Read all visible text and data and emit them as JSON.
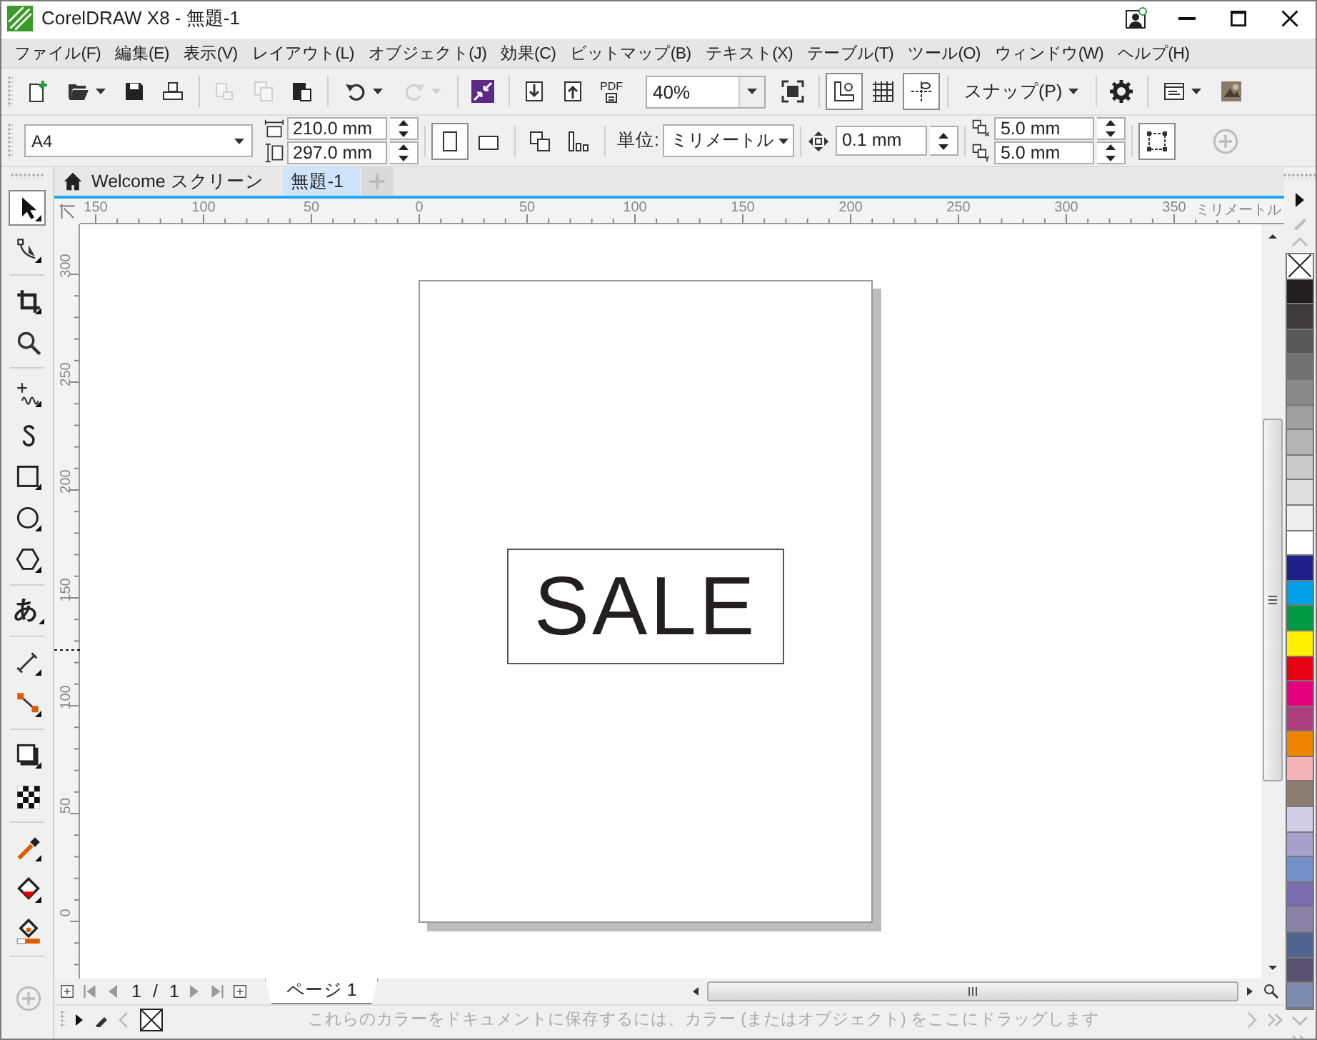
{
  "window": {
    "title": "CorelDRAW X8 - 無題-1"
  },
  "menu": [
    "ファイル(F)",
    "編集(E)",
    "表示(V)",
    "レイアウト(L)",
    "オブジェクト(J)",
    "効果(C)",
    "ビットマップ(B)",
    "テキスト(X)",
    "テーブル(T)",
    "ツール(O)",
    "ウィンドウ(W)",
    "ヘルプ(H)"
  ],
  "toolbar": [
    {
      "kind": "new",
      "disabled": false
    },
    {
      "kind": "open",
      "disabled": false
    },
    {
      "kind": "save",
      "disabled": false
    },
    {
      "kind": "print",
      "disabled": false
    },
    {
      "kind": "sep"
    },
    {
      "kind": "cut",
      "disabled": true
    },
    {
      "kind": "copy",
      "disabled": true
    },
    {
      "kind": "paste",
      "disabled": false
    },
    {
      "kind": "sep"
    },
    {
      "kind": "undo",
      "disabled": false
    },
    {
      "kind": "redo",
      "disabled": true
    },
    {
      "kind": "sep"
    },
    {
      "kind": "launch",
      "disabled": false
    },
    {
      "kind": "sep"
    },
    {
      "kind": "import",
      "disabled": false
    },
    {
      "kind": "export",
      "disabled": false
    },
    {
      "kind": "pdf",
      "label": "PDF",
      "disabled": false
    },
    {
      "kind": "zoom",
      "value": "40%"
    },
    {
      "kind": "fullscreen",
      "disabled": false
    },
    {
      "kind": "sep"
    },
    {
      "kind": "rulers",
      "on": true
    },
    {
      "kind": "grid",
      "on": false
    },
    {
      "kind": "guides",
      "on": true
    },
    {
      "kind": "sep"
    },
    {
      "kind": "snap",
      "label": "スナップ(P)"
    },
    {
      "kind": "sep"
    },
    {
      "kind": "options",
      "disabled": false
    },
    {
      "kind": "sep"
    },
    {
      "kind": "window",
      "disabled": false
    },
    {
      "kind": "thumb",
      "disabled": false
    }
  ],
  "property_bar": {
    "page_size": "A4",
    "width": "210.0 mm",
    "height": "297.0 mm",
    "orientation": [
      {
        "kind": "portrait",
        "selected": true
      },
      {
        "kind": "landscape",
        "selected": false
      }
    ],
    "units_label": "単位:",
    "units": "ミリメートル",
    "nudge": "0.1 mm",
    "duplicate_x": "5.0 mm",
    "duplicate_y": "5.0 mm"
  },
  "tabs": [
    {
      "label": "Welcome スクリーン",
      "kind": "home",
      "selected": false
    },
    {
      "label": "無題-1",
      "kind": "doc",
      "selected": true
    }
  ],
  "ruler_h": {
    "labels": [
      "150",
      "100",
      "50",
      "0",
      "50",
      "100",
      "150",
      "200",
      "250",
      "300",
      "350"
    ],
    "unit": "ミリメートル"
  },
  "ruler_v": {
    "labels": [
      "300",
      "250",
      "200",
      "150",
      "100",
      "50",
      "0"
    ]
  },
  "toolbox": [
    {
      "tools": [
        {
          "kind": "pick",
          "selected": true
        },
        {
          "kind": "shape",
          "selected": false
        }
      ]
    },
    {
      "tools": [
        {
          "kind": "crop",
          "selected": false
        },
        {
          "kind": "zoom",
          "selected": false
        }
      ]
    },
    {
      "tools": [
        {
          "kind": "freehand",
          "selected": false
        },
        {
          "kind": "artistic",
          "selected": false
        },
        {
          "kind": "rectangle",
          "selected": false
        },
        {
          "kind": "ellipse",
          "selected": false
        },
        {
          "kind": "polygon",
          "selected": false
        }
      ]
    },
    {
      "tools": [
        {
          "kind": "text",
          "glyph": "あ",
          "selected": false
        }
      ]
    },
    {
      "tools": [
        {
          "kind": "dimension",
          "selected": false
        },
        {
          "kind": "connector",
          "selected": false
        }
      ]
    },
    {
      "tools": [
        {
          "kind": "shadow",
          "selected": false
        },
        {
          "kind": "transparency",
          "selected": false
        }
      ]
    },
    {
      "tools": [
        {
          "kind": "eyedropper",
          "selected": false
        },
        {
          "kind": "fill",
          "selected": false
        },
        {
          "kind": "smartfill",
          "selected": false
        }
      ]
    }
  ],
  "canvas": {
    "text": "SALE"
  },
  "page_nav": {
    "current": "1",
    "separator": "/",
    "total": "1",
    "page_tab": "ページ 1"
  },
  "palette": [
    {
      "kind": "none"
    },
    {
      "kind": "color",
      "color": "#231f20"
    },
    {
      "kind": "color",
      "color": "#3e3a39"
    },
    {
      "kind": "color",
      "color": "#595757"
    },
    {
      "kind": "color",
      "color": "#727171"
    },
    {
      "kind": "color",
      "color": "#898989"
    },
    {
      "kind": "color",
      "color": "#9fa0a0"
    },
    {
      "kind": "color",
      "color": "#b5b5b6"
    },
    {
      "kind": "color",
      "color": "#c9caca"
    },
    {
      "kind": "color",
      "color": "#dcdddd"
    },
    {
      "kind": "color",
      "color": "#efefef"
    },
    {
      "kind": "color",
      "color": "#ffffff"
    },
    {
      "kind": "color",
      "color": "#1d2088"
    },
    {
      "kind": "color",
      "color": "#00a0e9"
    },
    {
      "kind": "color",
      "color": "#009944"
    },
    {
      "kind": "color",
      "color": "#fff100"
    },
    {
      "kind": "color",
      "color": "#e60012"
    },
    {
      "kind": "color",
      "color": "#e4007f"
    },
    {
      "kind": "color",
      "color": "#ad3f80"
    },
    {
      "kind": "color",
      "color": "#f08300"
    },
    {
      "kind": "color",
      "color": "#f4b3b5"
    },
    {
      "kind": "color",
      "color": "#8b7b70"
    },
    {
      "kind": "color",
      "color": "#d0cde6"
    },
    {
      "kind": "color",
      "color": "#a99fcd"
    },
    {
      "kind": "color",
      "color": "#7490c9"
    },
    {
      "kind": "color",
      "color": "#7a6aae"
    },
    {
      "kind": "color",
      "color": "#8c82a8"
    },
    {
      "kind": "color",
      "color": "#4f6490"
    },
    {
      "kind": "color",
      "color": "#5a5070"
    },
    {
      "kind": "color",
      "color": "#7b8bae"
    }
  ],
  "status": {
    "hint": "これらのカラーをドキュメントに保存するには、カラー (またはオブジェクト) をここにドラッグします"
  }
}
